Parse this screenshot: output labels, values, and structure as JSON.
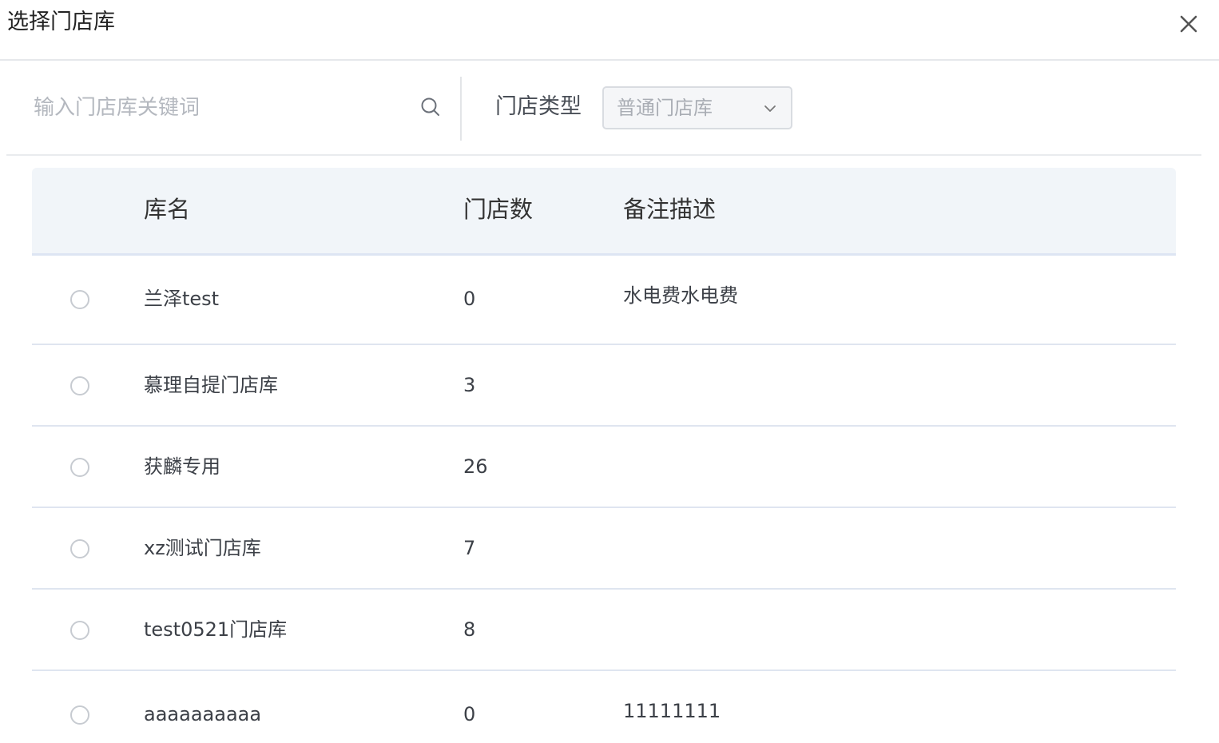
{
  "dialog": {
    "title": "选择门店库"
  },
  "filter": {
    "search_placeholder": "输入门店库关键词",
    "type_label": "门店类型",
    "type_value": "普通门店库"
  },
  "table": {
    "headers": [
      "库名",
      "门店数",
      "备注描述"
    ],
    "rows": [
      {
        "name": "兰泽test",
        "count": "0",
        "desc": "水电费水电费"
      },
      {
        "name": "慕理自提门店库",
        "count": "3",
        "desc": ""
      },
      {
        "name": "获麟专用",
        "count": "26",
        "desc": ""
      },
      {
        "name": "xz测试门店库",
        "count": "7",
        "desc": ""
      },
      {
        "name": "test0521门店库",
        "count": "8",
        "desc": ""
      },
      {
        "name": "aaaaaaaaaa",
        "count": "0",
        "desc": "11111111"
      }
    ]
  },
  "icons": [
    "close-icon",
    "search-icon",
    "chevron-down-icon",
    "radio-icon"
  ],
  "colors": {
    "header_bg": "#f1f5f9",
    "row_border": "#dfe5f0",
    "placeholder": "#b4b8bf"
  }
}
